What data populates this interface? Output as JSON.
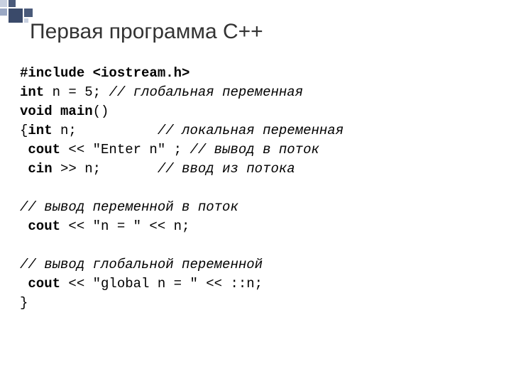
{
  "title": "Первая программа С++",
  "code": {
    "l1_kw": "#include",
    "l1_rest": " <iostream.h>",
    "l2_kw": "int",
    "l2_rest": " n = 5; ",
    "l2_comment": "// глобальная переменная",
    "l3_kw": "void main",
    "l3_rest": "()",
    "l4_brace": "{",
    "l4_kw": "int",
    "l4_rest": " n;          ",
    "l4_comment": "// локальная переменная",
    "l5_sp": " ",
    "l5_kw": "cout",
    "l5_rest": " << \"Enter n\" ; ",
    "l5_comment": "// вывод в поток",
    "l6_sp": " ",
    "l6_kw": "cin",
    "l6_rest": " >> n;       ",
    "l6_comment": "// ввод из потока",
    "blank1": "",
    "l7_comment": "// вывод переменной в поток",
    "l8_sp": " ",
    "l8_kw": "cout",
    "l8_rest": " << \"n = \" << n;",
    "blank2": "",
    "l9_comment": "// вывод глобальной переменной",
    "l10_sp": " ",
    "l10_kw": "cout",
    "l10_rest": " << \"global n = \" << ::n;",
    "l11": "}"
  }
}
